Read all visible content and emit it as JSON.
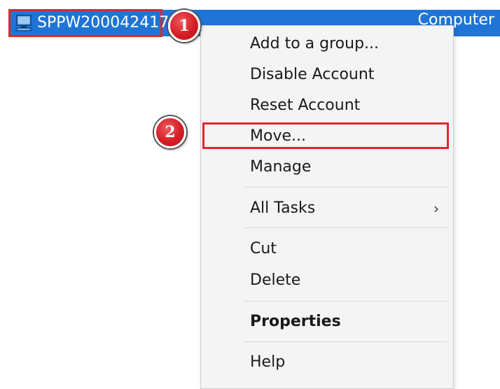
{
  "selected_row": {
    "name": "SPPW200042417",
    "type": "Computer",
    "icon": "computer-icon"
  },
  "context_menu": {
    "items": [
      {
        "label": "Add to a group...",
        "bold": false,
        "submenu": false
      },
      {
        "label": "Disable Account",
        "bold": false,
        "submenu": false
      },
      {
        "label": "Reset Account",
        "bold": false,
        "submenu": false
      },
      {
        "label": "Move...",
        "bold": false,
        "submenu": false
      },
      {
        "label": "Manage",
        "bold": false,
        "submenu": false
      },
      {
        "label": "All Tasks",
        "bold": false,
        "submenu": true
      },
      {
        "label": "Cut",
        "bold": false,
        "submenu": false
      },
      {
        "label": "Delete",
        "bold": false,
        "submenu": false
      },
      {
        "label": "Properties",
        "bold": true,
        "submenu": false
      },
      {
        "label": "Help",
        "bold": false,
        "submenu": false
      }
    ],
    "submenu_glyph": "›"
  },
  "annotations": {
    "step1": "1",
    "step2": "2"
  },
  "colors": {
    "selection": "#1f74d6",
    "annotation": "#e1262f",
    "menu_bg": "#f4f4f4"
  }
}
